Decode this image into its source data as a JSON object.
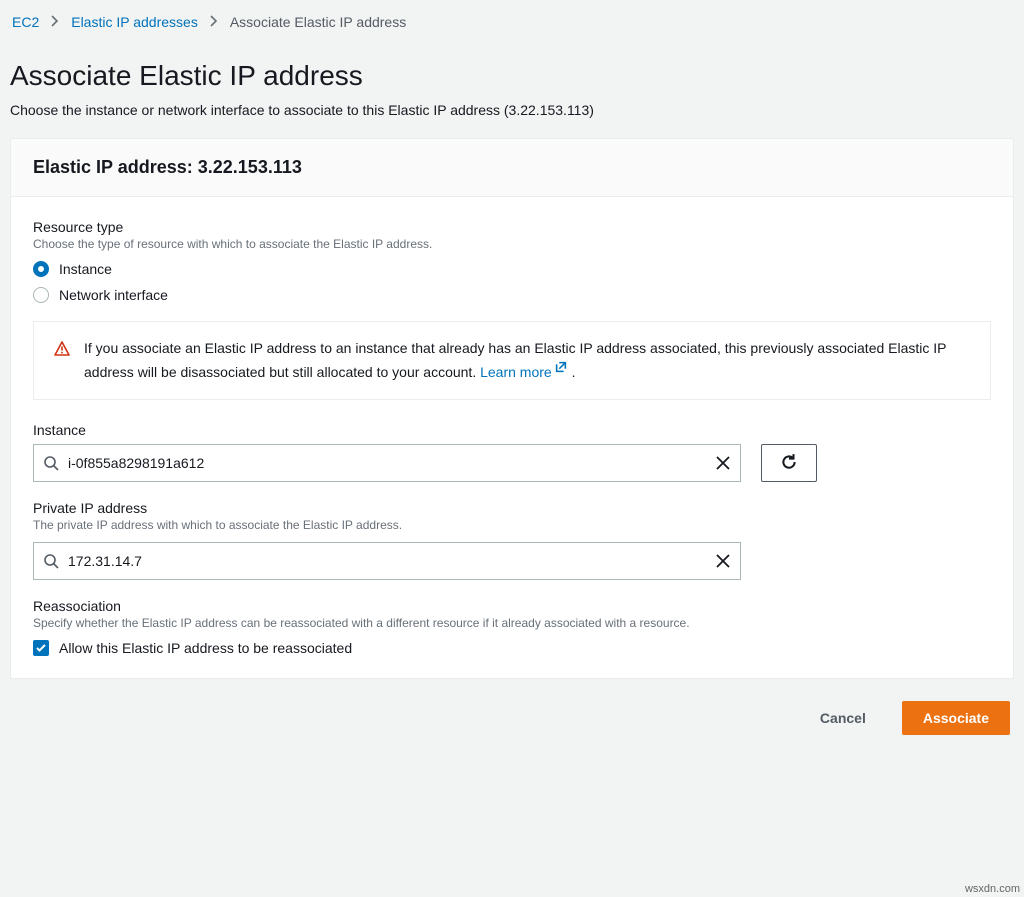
{
  "breadcrumb": {
    "items": [
      {
        "label": "EC2",
        "link": true
      },
      {
        "label": "Elastic IP addresses",
        "link": true
      },
      {
        "label": "Associate Elastic IP address",
        "link": false
      }
    ]
  },
  "header": {
    "title": "Associate Elastic IP address",
    "description": "Choose the instance or network interface to associate to this Elastic IP address (3.22.153.113)"
  },
  "panel": {
    "title_prefix": "Elastic IP address: ",
    "ip": "3.22.153.113"
  },
  "resource_type": {
    "label": "Resource type",
    "hint": "Choose the type of resource with which to associate the Elastic IP address.",
    "options": {
      "instance": "Instance",
      "network_interface": "Network interface"
    },
    "selected": "instance"
  },
  "info": {
    "text": "If you associate an Elastic IP address to an instance that already has an Elastic IP address associated, this previously associated Elastic IP address will be disassociated but still allocated to your account. ",
    "learn_more": "Learn more",
    "trailing": "."
  },
  "instance_field": {
    "label": "Instance",
    "value": "i-0f855a8298191a612"
  },
  "private_ip_field": {
    "label": "Private IP address",
    "hint": "The private IP address with which to associate the Elastic IP address.",
    "value": "172.31.14.7"
  },
  "reassociation": {
    "label": "Reassociation",
    "hint": "Specify whether the Elastic IP address can be reassociated with a different resource if it already associated with a resource.",
    "checkbox_label": "Allow this Elastic IP address to be reassociated",
    "checked": true
  },
  "footer": {
    "cancel": "Cancel",
    "associate": "Associate"
  },
  "watermark": "wsxdn.com"
}
